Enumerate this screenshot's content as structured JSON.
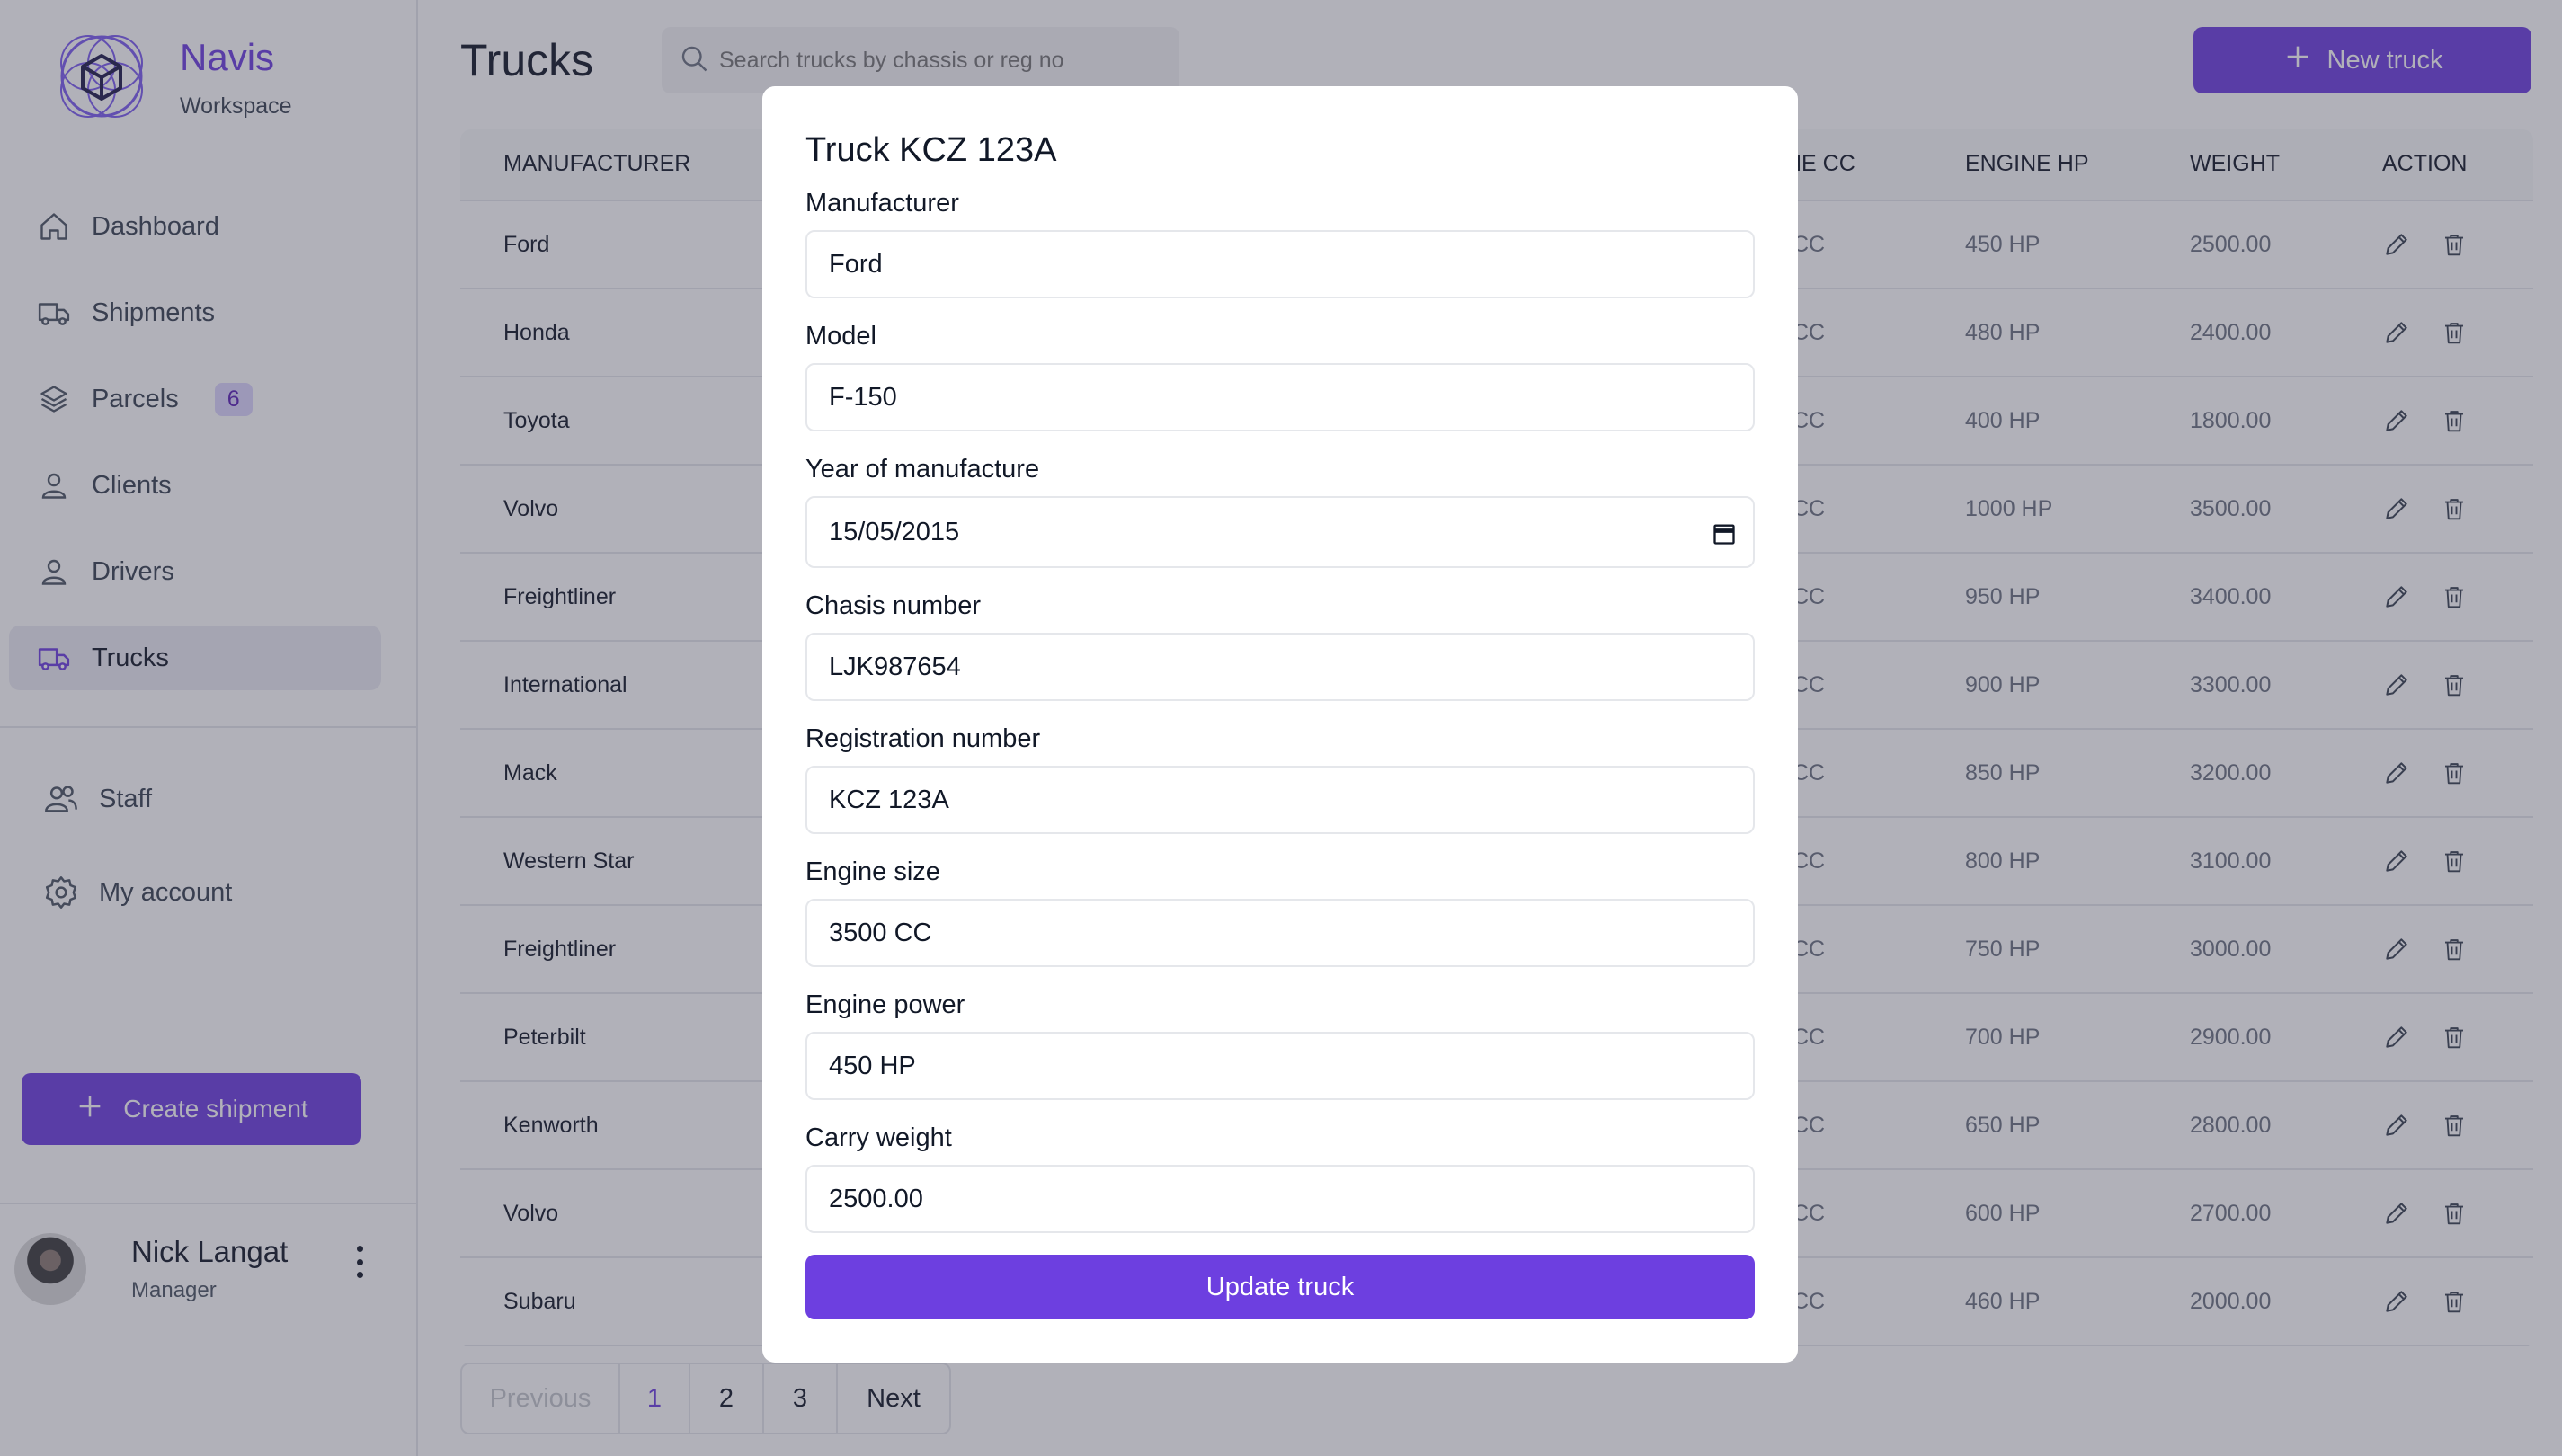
{
  "brand": {
    "name": "Navis",
    "subtitle": "Workspace"
  },
  "nav": {
    "items": [
      {
        "label": "Dashboard",
        "icon": "home-icon"
      },
      {
        "label": "Shipments",
        "icon": "truck-icon"
      },
      {
        "label": "Parcels",
        "icon": "layers-icon",
        "badge": "6"
      },
      {
        "label": "Clients",
        "icon": "user-icon"
      },
      {
        "label": "Drivers",
        "icon": "user-icon"
      },
      {
        "label": "Trucks",
        "icon": "truck-icon",
        "active": true
      }
    ],
    "secondary": [
      {
        "label": "Staff",
        "icon": "users-icon"
      },
      {
        "label": "My account",
        "icon": "gear-icon"
      }
    ],
    "create_label": "Create shipment"
  },
  "user": {
    "name": "Nick Langat",
    "role": "Manager"
  },
  "page": {
    "title": "Trucks",
    "search_placeholder": "Search trucks by chassis or reg no",
    "new_label": "New truck"
  },
  "table": {
    "headers": {
      "manufacturer": "MANUFACTURER",
      "engine_cc": "NE CC",
      "engine_hp": "ENGINE HP",
      "weight": "WEIGHT",
      "action": "ACTION"
    },
    "rows": [
      {
        "manufacturer": "Ford",
        "cc": "CC",
        "hp": "450 HP",
        "weight": "2500.00"
      },
      {
        "manufacturer": "Honda",
        "cc": "CC",
        "hp": "480 HP",
        "weight": "2400.00"
      },
      {
        "manufacturer": "Toyota",
        "cc": "CC",
        "hp": "400 HP",
        "weight": "1800.00"
      },
      {
        "manufacturer": "Volvo",
        "cc": "CC",
        "hp": "1000 HP",
        "weight": "3500.00"
      },
      {
        "manufacturer": "Freightliner",
        "cc": "CC",
        "hp": "950 HP",
        "weight": "3400.00"
      },
      {
        "manufacturer": "International",
        "cc": "CC",
        "hp": "900 HP",
        "weight": "3300.00"
      },
      {
        "manufacturer": "Mack",
        "cc": "CC",
        "hp": "850 HP",
        "weight": "3200.00"
      },
      {
        "manufacturer": "Western Star",
        "cc": "CC",
        "hp": "800 HP",
        "weight": "3100.00"
      },
      {
        "manufacturer": "Freightliner",
        "cc": "CC",
        "hp": "750 HP",
        "weight": "3000.00"
      },
      {
        "manufacturer": "Peterbilt",
        "cc": "CC",
        "hp": "700 HP",
        "weight": "2900.00"
      },
      {
        "manufacturer": "Kenworth",
        "cc": "CC",
        "hp": "650 HP",
        "weight": "2800.00"
      },
      {
        "manufacturer": "Volvo",
        "cc": "CC",
        "hp": "600 HP",
        "weight": "2700.00"
      },
      {
        "manufacturer": "Subaru",
        "cc": "CC",
        "hp": "460 HP",
        "weight": "2000.00"
      }
    ]
  },
  "pagination": {
    "previous": "Previous",
    "pages": [
      "1",
      "2",
      "3"
    ],
    "current": "1",
    "next": "Next"
  },
  "modal": {
    "title": "Truck KCZ 123A",
    "fields": [
      {
        "label": "Manufacturer",
        "value": "Ford"
      },
      {
        "label": "Model",
        "value": "F-150"
      },
      {
        "label": "Year of manufacture",
        "value": "15/05/2015"
      },
      {
        "label": "Chasis number",
        "value": "LJK987654"
      },
      {
        "label": "Registration number",
        "value": "KCZ 123A"
      },
      {
        "label": "Engine size",
        "value": "3500 CC"
      },
      {
        "label": "Engine power",
        "value": "450 HP"
      },
      {
        "label": "Carry weight",
        "value": "2500.00"
      }
    ],
    "submit_label": "Update truck"
  },
  "colors": {
    "accent": "#6d3fe0",
    "overlay": "#3c3c50"
  }
}
